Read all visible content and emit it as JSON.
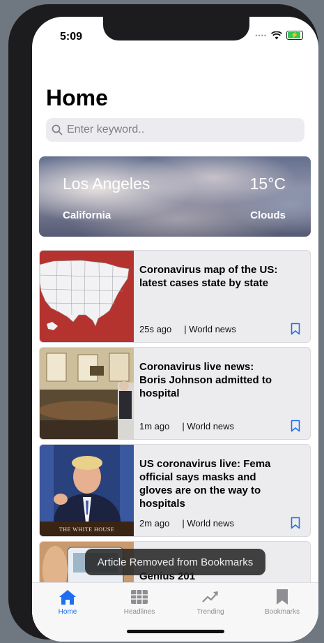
{
  "status_bar": {
    "time": "5:09"
  },
  "header": {
    "title": "Home"
  },
  "search": {
    "placeholder": "Enter keyword.."
  },
  "weather": {
    "city": "Los Angeles",
    "state": "California",
    "temperature": "15°C",
    "condition": "Clouds"
  },
  "articles": [
    {
      "title": "Coronavirus map of the US: latest cases state by state",
      "time": "25s ago",
      "category": "| World news"
    },
    {
      "title": "Coronavirus live news: Boris Johnson admitted to hospital",
      "time": "1m ago",
      "category": "| World news"
    },
    {
      "title": "US coronavirus live: Fema official says masks and gloves are on the way to hospitals",
      "time": "2m ago",
      "category": "| World news",
      "image_caption": "THE WHITE HOUSE"
    },
    {
      "title": "Genius 201"
    }
  ],
  "toast": {
    "message": "Article Removed from Bookmarks"
  },
  "tabbar": {
    "tabs": [
      {
        "label": "Home",
        "icon": "home-icon",
        "active": true
      },
      {
        "label": "Headlines",
        "icon": "grid-icon",
        "active": false
      },
      {
        "label": "Trending",
        "icon": "trending-icon",
        "active": false
      },
      {
        "label": "Bookmarks",
        "icon": "bookmark-icon",
        "active": false
      }
    ]
  },
  "colors": {
    "accent": "#1d6ef0",
    "map_red": "#b5332f",
    "card_bg": "#ececee"
  }
}
